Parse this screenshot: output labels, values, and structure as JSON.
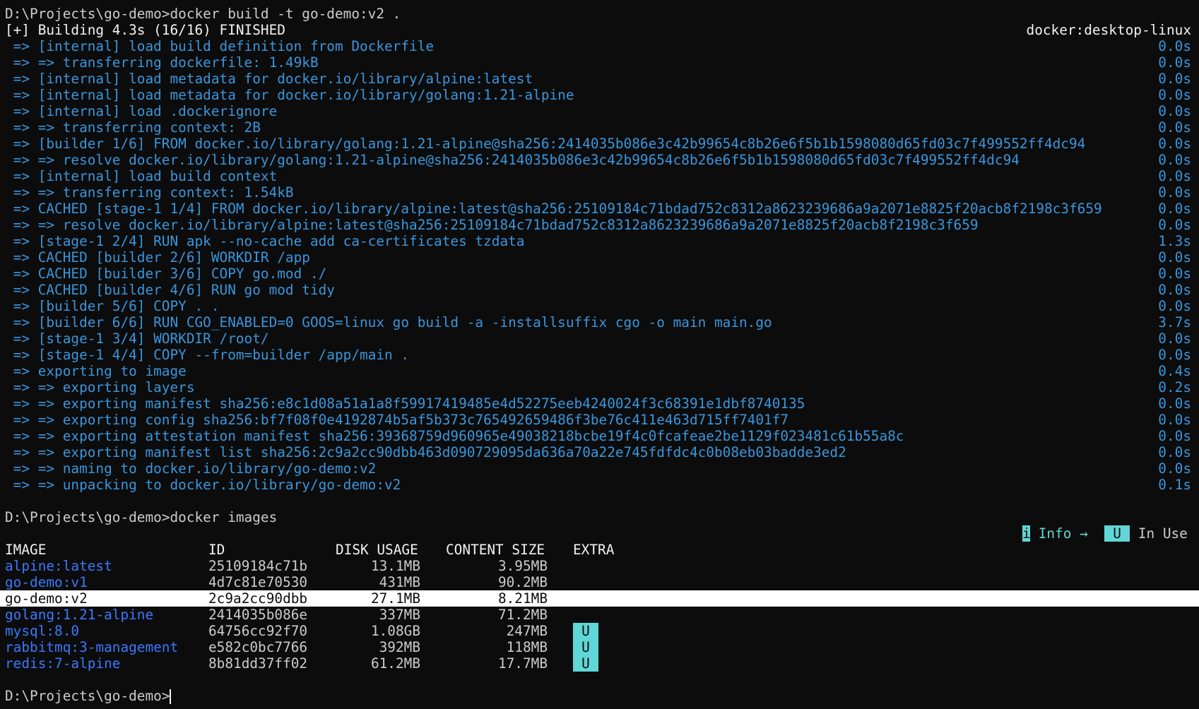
{
  "build": {
    "prompt": "D:\\Projects\\go-demo>",
    "command": "docker build -t go-demo:v2 .",
    "summary": "[+] Building 4.3s (16/16) FINISHED",
    "context": "docker:desktop-linux",
    "steps": [
      {
        "text": " => [internal] load build definition from Dockerfile",
        "time": "0.0s"
      },
      {
        "text": " => => transferring dockerfile: 1.49kB",
        "time": "0.0s"
      },
      {
        "text": " => [internal] load metadata for docker.io/library/alpine:latest",
        "time": "0.0s"
      },
      {
        "text": " => [internal] load metadata for docker.io/library/golang:1.21-alpine",
        "time": "0.0s"
      },
      {
        "text": " => [internal] load .dockerignore",
        "time": "0.0s"
      },
      {
        "text": " => => transferring context: 2B",
        "time": "0.0s"
      },
      {
        "text": " => [builder 1/6] FROM docker.io/library/golang:1.21-alpine@sha256:2414035b086e3c42b99654c8b26e6f5b1b1598080d65fd03c7f499552ff4dc94",
        "time": "0.0s"
      },
      {
        "text": " => => resolve docker.io/library/golang:1.21-alpine@sha256:2414035b086e3c42b99654c8b26e6f5b1b1598080d65fd03c7f499552ff4dc94",
        "time": "0.0s"
      },
      {
        "text": " => [internal] load build context",
        "time": "0.0s"
      },
      {
        "text": " => => transferring context: 1.54kB",
        "time": "0.0s"
      },
      {
        "text": " => CACHED [stage-1 1/4] FROM docker.io/library/alpine:latest@sha256:25109184c71bdad752c8312a8623239686a9a2071e8825f20acb8f2198c3f659",
        "time": "0.0s"
      },
      {
        "text": " => => resolve docker.io/library/alpine:latest@sha256:25109184c71bdad752c8312a8623239686a9a2071e8825f20acb8f2198c3f659",
        "time": "0.0s"
      },
      {
        "text": " => [stage-1 2/4] RUN apk --no-cache add ca-certificates tzdata",
        "time": "1.3s"
      },
      {
        "text": " => CACHED [builder 2/6] WORKDIR /app",
        "time": "0.0s"
      },
      {
        "text": " => CACHED [builder 3/6] COPY go.mod ./",
        "time": "0.0s"
      },
      {
        "text": " => CACHED [builder 4/6] RUN go mod tidy",
        "time": "0.0s"
      },
      {
        "text": " => [builder 5/6] COPY . .",
        "time": "0.0s"
      },
      {
        "text": " => [builder 6/6] RUN CGO_ENABLED=0 GOOS=linux go build -a -installsuffix cgo -o main main.go",
        "time": "3.7s"
      },
      {
        "text": " => [stage-1 3/4] WORKDIR /root/",
        "time": "0.0s"
      },
      {
        "text": " => [stage-1 4/4] COPY --from=builder /app/main .",
        "time": "0.0s"
      },
      {
        "text": " => exporting to image",
        "time": "0.4s"
      },
      {
        "text": " => => exporting layers",
        "time": "0.2s"
      },
      {
        "text": " => => exporting manifest sha256:e8c1d08a51a1a8f59917419485e4d52275eeb4240024f3c68391e1dbf8740135",
        "time": "0.0s"
      },
      {
        "text": " => => exporting config sha256:bf7f08f0e4192874b5af5b373c765492659486f3be76c411e463d715ff7401f7",
        "time": "0.0s"
      },
      {
        "text": " => => exporting attestation manifest sha256:39368759d960965e49038218bcbe19f4c0fcafeae2be1129f023481c61b55a8c",
        "time": "0.0s"
      },
      {
        "text": " => => exporting manifest list sha256:2c9a2cc90dbb463d090729095da636a70a22e745fdfdc4c0b08eb03badde3ed2",
        "time": "0.0s"
      },
      {
        "text": " => => naming to docker.io/library/go-demo:v2",
        "time": "0.0s"
      },
      {
        "text": " => => unpacking to docker.io/library/go-demo:v2",
        "time": "0.1s"
      }
    ]
  },
  "images": {
    "prompt": "D:\\Projects\\go-demo>",
    "command": "docker images",
    "legend": {
      "info_tag": "i",
      "info_label": "Info",
      "info_arrow": "→",
      "inuse_tag": "U",
      "inuse_label": "In Use"
    },
    "headers": {
      "image": "IMAGE",
      "id": "ID",
      "disk": "DISK USAGE",
      "content": "CONTENT SIZE",
      "extra": "EXTRA"
    },
    "rows": [
      {
        "image": "alpine:latest",
        "id": "25109184c71b",
        "disk": "13.1MB",
        "content": "3.95MB",
        "extra": ""
      },
      {
        "image": "go-demo:v1",
        "id": "4d7c81e70530",
        "disk": "431MB",
        "content": "90.2MB",
        "extra": ""
      },
      {
        "image": "go-demo:v2",
        "id": "2c9a2cc90dbb",
        "disk": "27.1MB",
        "content": "8.21MB",
        "extra": "",
        "selected": true
      },
      {
        "image": "golang:1.21-alpine",
        "id": "2414035b086e",
        "disk": "337MB",
        "content": "71.2MB",
        "extra": ""
      },
      {
        "image": "mysql:8.0",
        "id": "64756cc92f70",
        "disk": "1.08GB",
        "content": "247MB",
        "extra": "U"
      },
      {
        "image": "rabbitmq:3-management",
        "id": "e582c0bc7766",
        "disk": "392MB",
        "content": "118MB",
        "extra": "U"
      },
      {
        "image": "redis:7-alpine",
        "id": "8b81dd37ff02",
        "disk": "61.2MB",
        "content": "17.7MB",
        "extra": "U"
      }
    ]
  },
  "final_prompt": "D:\\Projects\\go-demo>",
  "colors": {
    "background": "#0c0c0c",
    "foreground": "#cccccc",
    "step_blue": "#3a96dd",
    "image_link": "#3b78ff",
    "tag_cyan": "#61d6d6",
    "selection": "#ffffff"
  }
}
